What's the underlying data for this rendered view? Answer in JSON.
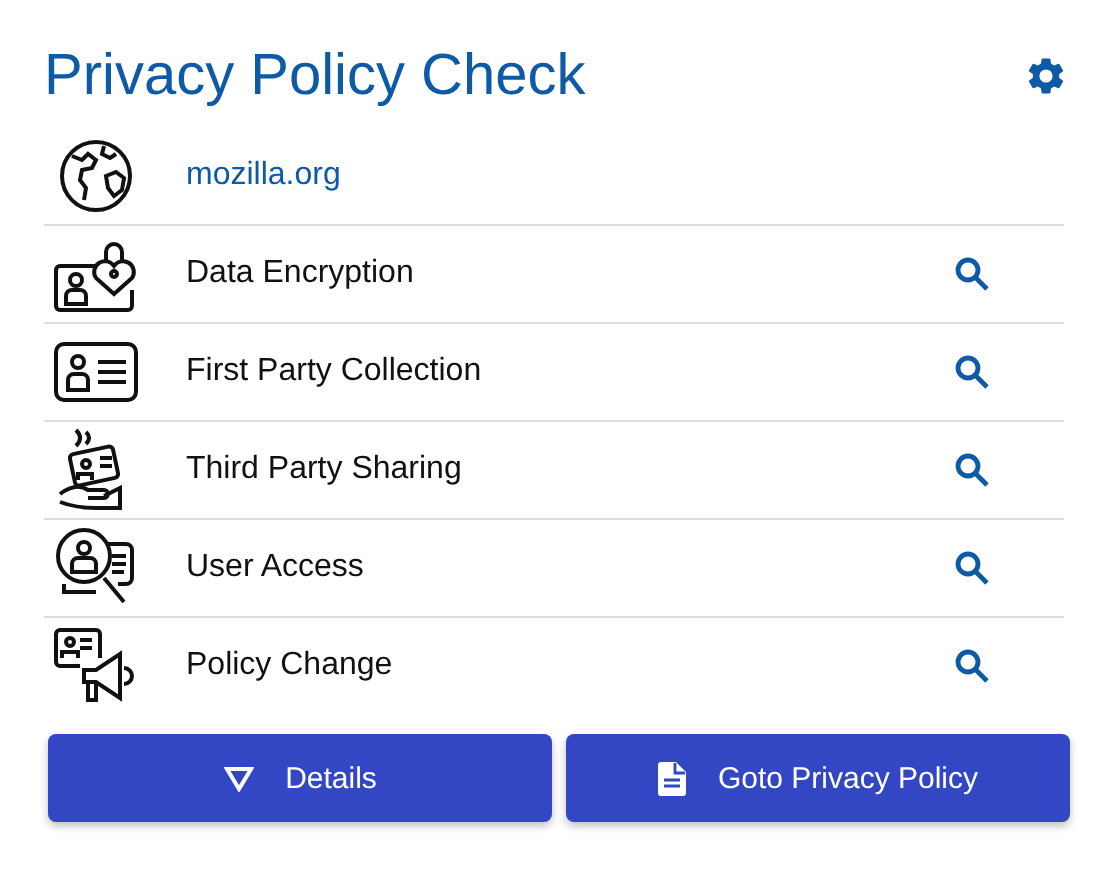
{
  "title": "Privacy Policy Check",
  "rows": [
    {
      "kind": "site",
      "label": "mozilla.org"
    },
    {
      "kind": "check",
      "label": "Data Encryption"
    },
    {
      "kind": "check",
      "label": "First Party Collection"
    },
    {
      "kind": "check",
      "label": "Third Party Sharing"
    },
    {
      "kind": "check",
      "label": "User Access"
    },
    {
      "kind": "check",
      "label": "Policy Change"
    }
  ],
  "buttons": [
    {
      "kind": "details",
      "label": "Details"
    },
    {
      "kind": "goto",
      "label": "Goto Privacy Policy"
    }
  ]
}
